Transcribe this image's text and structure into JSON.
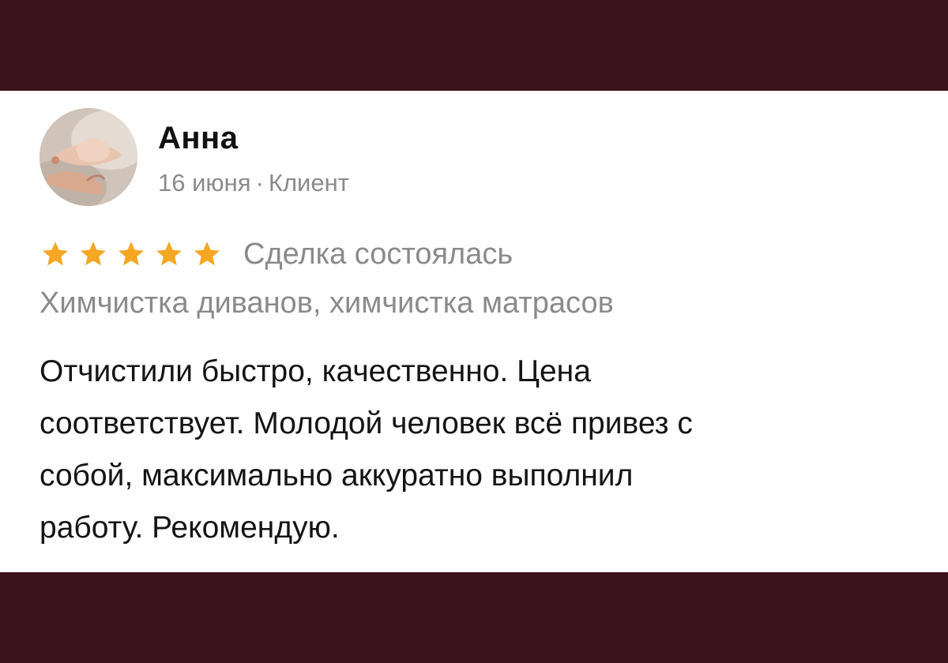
{
  "review": {
    "author": "Анна",
    "date": "16 июня",
    "separator": "·",
    "role": "Клиент",
    "rating": 5,
    "rating_max": 5,
    "status": "Сделка состоялась",
    "services": "Химчистка диванов, химчистка матрасов",
    "text": "Отчистили быстро, качественно. Цена\nсоответствует.  Молодой человек всё привез с\nсобой,  максимально аккуратно выполнил\nработу.  Рекомендую."
  },
  "colors": {
    "background": "#3a131d",
    "card": "#ffffff",
    "star": "#f5a623",
    "muted_text": "#8a8a8a",
    "main_text": "#141414"
  },
  "icons": {
    "avatar": "user-photo-avatar",
    "star": "star-icon"
  }
}
